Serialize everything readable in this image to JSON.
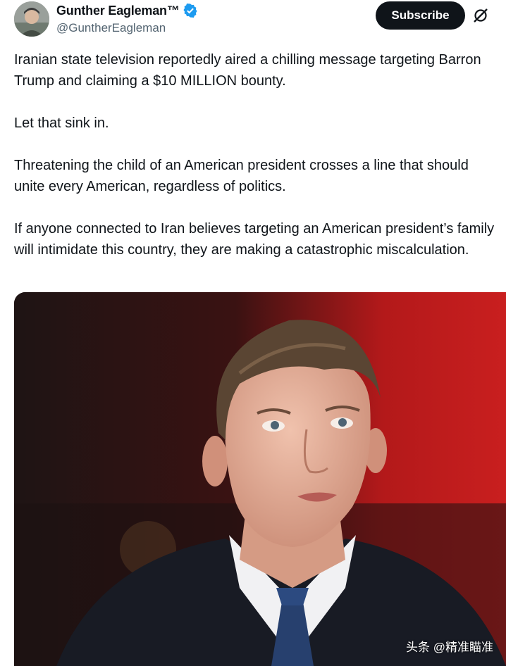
{
  "author": {
    "display_name": "Gunther Eagleman™",
    "handle": "@GuntherEagleman",
    "verified": true,
    "avatar_icon": "avatar-photo"
  },
  "actions": {
    "subscribe_label": "Subscribe",
    "grok_icon": "grok-icon"
  },
  "tweet": {
    "paragraphs": [
      "Iranian state television reportedly aired a chilling message targeting Barron Trump and claiming a $10 MILLION bounty.",
      "Let that sink in.",
      "Threatening the child of an American president crosses a line that should unite every American, regardless of politics.",
      "If anyone connected to Iran believes targeting an American president’s family will intimidate this country, they are making a catastrophic miscalculation."
    ]
  },
  "media": {
    "watermark": "头条 @精准瞄准"
  },
  "colors": {
    "verified_blue": "#1d9bf0",
    "button_bg": "#0f1419",
    "secondary_text": "#536471"
  }
}
